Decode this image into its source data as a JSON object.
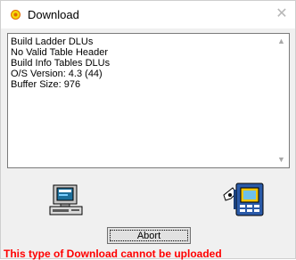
{
  "window": {
    "title": "Download",
    "title_icon": "download-status-icon",
    "close_icon": "close-icon",
    "close_glyph": "✕"
  },
  "log": {
    "lines": [
      "Build Ladder DLUs",
      "No Valid Table Header",
      "Build Info Tables DLUs",
      "O/S Version: 4.3 (44)",
      "Buffer Size: 976"
    ],
    "scroll_up_glyph": "▲",
    "scroll_down_glyph": "▼"
  },
  "icons": {
    "pc": "computer-icon",
    "device": "plc-device-icon"
  },
  "buttons": {
    "abort_label": "Abort"
  },
  "status": {
    "error_message": "This type of Download cannot be uploaded",
    "error_color": "#ff0000"
  },
  "colors": {
    "title_icon_fill": "#f5d90a",
    "title_icon_ring": "#e06a00"
  }
}
